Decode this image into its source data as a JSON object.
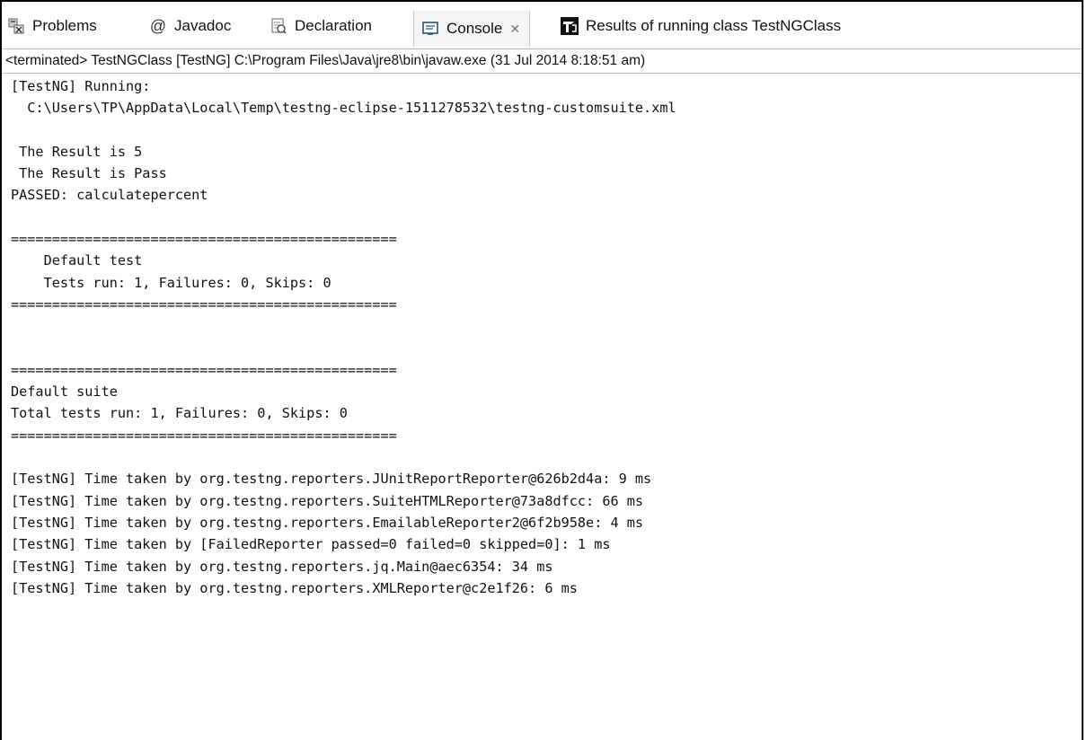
{
  "tabs": [
    {
      "label": "Problems",
      "icon": "problems-icon"
    },
    {
      "label": "Javadoc",
      "icon": "javadoc-icon"
    },
    {
      "label": "Declaration",
      "icon": "declaration-icon"
    },
    {
      "label": "Console",
      "icon": "console-icon",
      "active": true,
      "close": "✕"
    },
    {
      "label": "Results of running class TestNGClass",
      "icon": "testng-icon"
    }
  ],
  "status": "<terminated> TestNGClass [TestNG] C:\\Program Files\\Java\\jre8\\bin\\javaw.exe (31 Jul 2014 8:18:51 am)",
  "console_lines": [
    "[TestNG] Running:",
    "  C:\\Users\\TP\\AppData\\Local\\Temp\\testng-eclipse-1511278532\\testng-customsuite.xml",
    "",
    " The Result is 5",
    " The Result is Pass",
    "PASSED: calculatepercent",
    "",
    "===============================================",
    "    Default test",
    "    Tests run: 1, Failures: 0, Skips: 0",
    "===============================================",
    "",
    "",
    "===============================================",
    "Default suite",
    "Total tests run: 1, Failures: 0, Skips: 0",
    "===============================================",
    "",
    "[TestNG] Time taken by org.testng.reporters.JUnitReportReporter@626b2d4a: 9 ms",
    "[TestNG] Time taken by org.testng.reporters.SuiteHTMLReporter@73a8dfcc: 66 ms",
    "[TestNG] Time taken by org.testng.reporters.EmailableReporter2@6f2b958e: 4 ms",
    "[TestNG] Time taken by [FailedReporter passed=0 failed=0 skipped=0]: 1 ms",
    "[TestNG] Time taken by org.testng.reporters.jq.Main@aec6354: 34 ms",
    "[TestNG] Time taken by org.testng.reporters.XMLReporter@c2e1f26: 6 ms"
  ],
  "colors": {
    "accent": "#3b6fb6",
    "tab_active_bg": "#f4f4f4",
    "border": "#bdbdbd",
    "text": "#111111"
  }
}
